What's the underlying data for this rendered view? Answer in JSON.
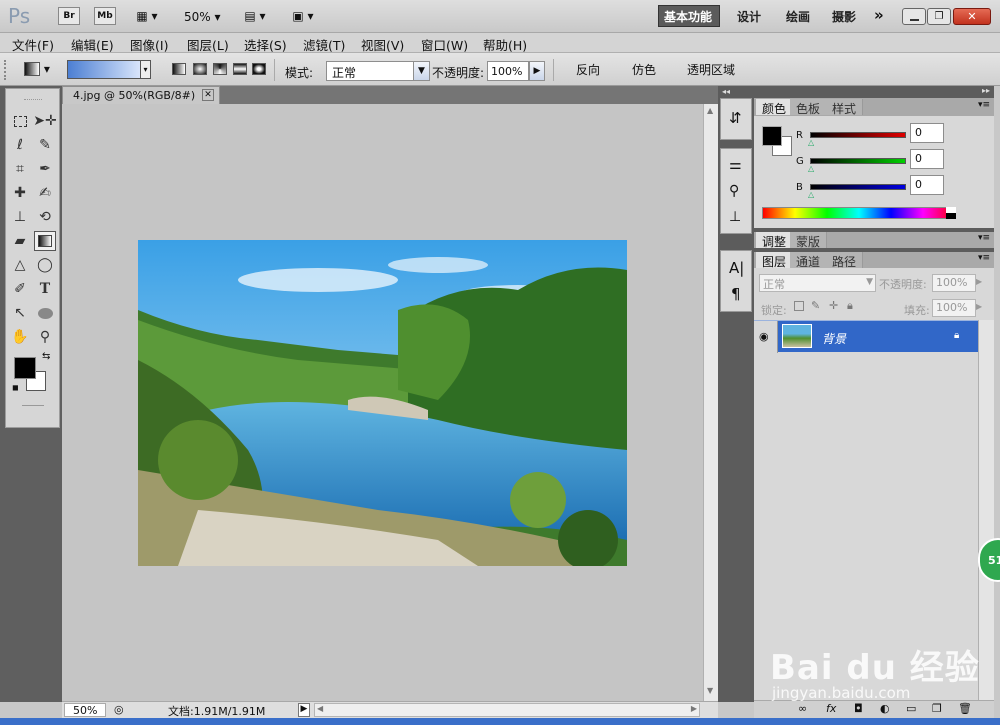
{
  "app": {
    "logo": "Ps",
    "bridge_label": "Br",
    "minibridge_label": "Mb",
    "zoom": "50%"
  },
  "workspaces": [
    "基本功能",
    "设计",
    "绘画",
    "摄影"
  ],
  "menu": [
    "文件(F)",
    "编辑(E)",
    "图像(I)",
    "图层(L)",
    "选择(S)",
    "滤镜(T)",
    "视图(V)",
    "窗口(W)",
    "帮助(H)"
  ],
  "options": {
    "mode_label": "模式:",
    "mode_value": "正常",
    "opacity_label": "不透明度:",
    "opacity_value": "100%",
    "reverse_label": "反向",
    "dither_label": "仿色",
    "transparency_label": "透明区域"
  },
  "document": {
    "tab_title": "4.jpg @ 50%(RGB/8#)",
    "zoom": "50%",
    "doc_info": "文档:1.91M/1.91M"
  },
  "color_panel": {
    "tabs": [
      "颜色",
      "色板",
      "样式"
    ],
    "channels": [
      {
        "name": "R",
        "value": "0"
      },
      {
        "name": "G",
        "value": "0"
      },
      {
        "name": "B",
        "value": "0"
      }
    ]
  },
  "adjust_panel": {
    "tabs": [
      "调整",
      "蒙版"
    ]
  },
  "layers_panel": {
    "tabs": [
      "图层",
      "通道",
      "路径"
    ],
    "blend_mode": "正常",
    "opacity_label": "不透明度:",
    "opacity_value": "100%",
    "lock_label": "锁定:",
    "fill_label": "填充:",
    "fill_value": "100%",
    "layer_name": "背景"
  },
  "watermark": {
    "brand": "Bai du 经验",
    "url": "jingyan.baidu.com"
  },
  "badge": "51"
}
